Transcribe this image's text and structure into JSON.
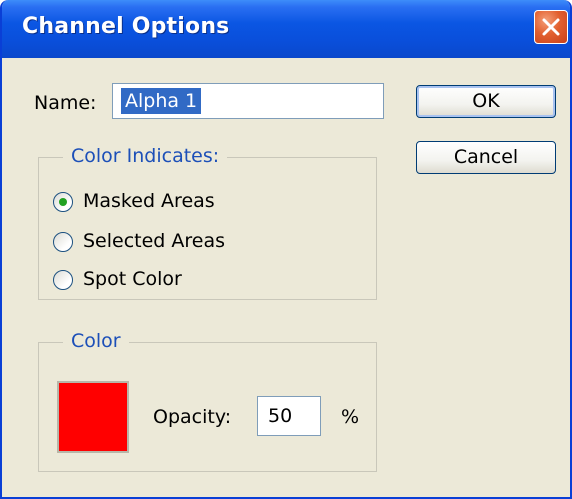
{
  "window": {
    "title": "Channel Options"
  },
  "name_field": {
    "label": "Name:",
    "value": "Alpha 1"
  },
  "buttons": {
    "ok_label": "OK",
    "cancel_label": "Cancel"
  },
  "color_indicates": {
    "legend": "Color Indicates:",
    "options": [
      {
        "label": "Masked Areas",
        "selected": true
      },
      {
        "label": "Selected Areas",
        "selected": false
      },
      {
        "label": "Spot Color",
        "selected": false
      }
    ]
  },
  "color": {
    "legend": "Color",
    "swatch_color": "#ff0000",
    "opacity_label": "Opacity:",
    "opacity_value": "50",
    "opacity_unit": "%"
  },
  "icons": {
    "close": "close-icon",
    "radio_selected": "radio-selected-icon",
    "radio_unselected": "radio-unselected-icon"
  },
  "colors": {
    "titlebar": "#0a4fdb",
    "dialog_bg": "#ece9d8",
    "legend_text": "#1c4fb8",
    "selection": "#316ac5",
    "close_button": "#e2602f"
  }
}
